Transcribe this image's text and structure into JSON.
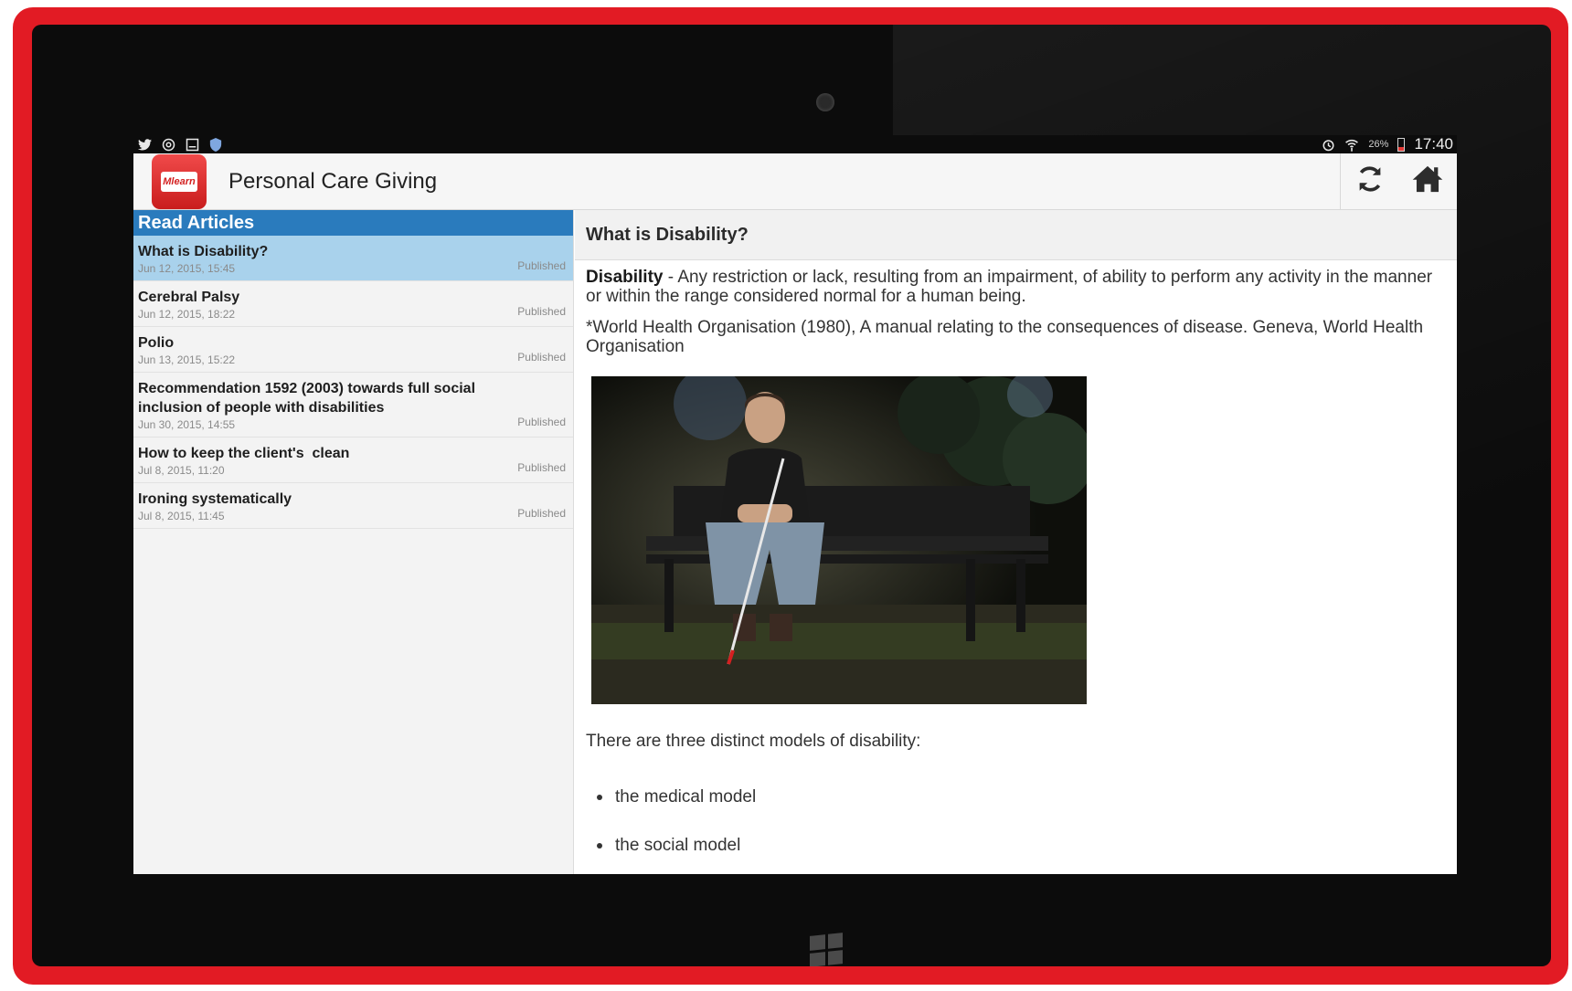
{
  "status_bar": {
    "left_icons": [
      "twitter-icon",
      "at-sign-icon",
      "message-icon",
      "shield-icon"
    ],
    "right_icons": [
      "alarm-icon",
      "wifi-icon",
      "battery-icon"
    ],
    "battery": "26%",
    "time": "17:40"
  },
  "app_bar": {
    "logo_text": "Mlearn",
    "title": "Personal Care Giving",
    "actions": [
      "refresh-icon",
      "home-icon"
    ]
  },
  "left_panel": {
    "header": "Read Articles",
    "articles": [
      {
        "title": "What is Disability?",
        "date": "Jun 12, 2015, 15:45",
        "status": "Published",
        "selected": true
      },
      {
        "title": "Cerebral Palsy",
        "date": "Jun 12, 2015, 18:22",
        "status": "Published",
        "selected": false
      },
      {
        "title": "Polio",
        "date": "Jun 13, 2015, 15:22",
        "status": "Published",
        "selected": false
      },
      {
        "title": "Recommendation 1592 (2003) towards full social inclusion of people with disabilities",
        "date": "Jun 30, 2015, 14:55",
        "status": "Published",
        "selected": false
      },
      {
        "title": "How to keep the client's  clean",
        "date": "Jul 8, 2015, 11:20",
        "status": "Published",
        "selected": false
      },
      {
        "title": "Ironing systematically",
        "date": "Jul 8, 2015, 11:45",
        "status": "Published",
        "selected": false
      }
    ]
  },
  "article_view": {
    "heading": "What is Disability?",
    "definition_term": "Disability",
    "definition_text": " - Any restriction or lack, resulting from an impairment, of ability to perform any activity in the manner or within the range considered normal for a human being.",
    "citation": "*World Health Organisation (1980), A manual relating to the consequences of disease. Geneva, World Health Organisation",
    "models_intro": "There are three distinct models of disability:",
    "models": [
      "the medical model",
      "the social model"
    ]
  },
  "colors": {
    "frame": "#e21b24",
    "header_blue": "#2a7bbd",
    "selected_row": "#a9d2ec"
  }
}
